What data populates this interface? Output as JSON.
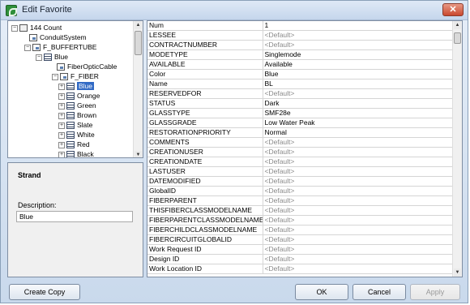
{
  "window": {
    "title": "Edit Favorite",
    "close_glyph": "✕"
  },
  "tree": {
    "items": [
      {
        "label": "144 Count",
        "icon": "count-icon",
        "expander": "−"
      },
      {
        "label": "ConduitSystem",
        "icon": "relationship-icon"
      },
      {
        "label": "F_BUFFERTUBE",
        "icon": "relationship-icon",
        "expander": "−"
      },
      {
        "label": "Blue",
        "icon": "table-icon",
        "expander": "−"
      },
      {
        "label": "FiberOpticCable",
        "icon": "relationship-icon"
      },
      {
        "label": "F_FIBER",
        "icon": "relationship-icon",
        "expander": "−"
      },
      {
        "label": "Blue",
        "icon": "table-icon",
        "expander": "+",
        "selected": true
      },
      {
        "label": "Orange",
        "icon": "table-icon",
        "expander": "+"
      },
      {
        "label": "Green",
        "icon": "table-icon",
        "expander": "+"
      },
      {
        "label": "Brown",
        "icon": "table-icon",
        "expander": "+"
      },
      {
        "label": "Slate",
        "icon": "table-icon",
        "expander": "+"
      },
      {
        "label": "White",
        "icon": "table-icon",
        "expander": "+"
      },
      {
        "label": "Red",
        "icon": "table-icon",
        "expander": "+"
      },
      {
        "label": "Black",
        "icon": "table-icon",
        "expander": "+"
      }
    ]
  },
  "details": {
    "title": "Strand",
    "description_label": "Description:",
    "description_value": "Blue"
  },
  "properties": [
    {
      "name": "Num",
      "value": "1"
    },
    {
      "name": "LESSEE",
      "value": "<Default>"
    },
    {
      "name": "CONTRACTNUMBER",
      "value": "<Default>"
    },
    {
      "name": "MODETYPE",
      "value": "Singlemode"
    },
    {
      "name": "AVAILABLE",
      "value": "Available"
    },
    {
      "name": "Color",
      "value": "Blue"
    },
    {
      "name": "Name",
      "value": "BL"
    },
    {
      "name": "RESERVEDFOR",
      "value": "<Default>"
    },
    {
      "name": "STATUS",
      "value": "Dark"
    },
    {
      "name": "GLASSTYPE",
      "value": "SMF28e"
    },
    {
      "name": "GLASSGRADE",
      "value": "Low Water Peak"
    },
    {
      "name": "RESTORATIONPRIORITY",
      "value": "Normal"
    },
    {
      "name": "COMMENTS",
      "value": "<Default>"
    },
    {
      "name": "CREATIONUSER",
      "value": "<Default>"
    },
    {
      "name": "CREATIONDATE",
      "value": "<Default>"
    },
    {
      "name": "LASTUSER",
      "value": "<Default>"
    },
    {
      "name": "DATEMODIFIED",
      "value": "<Default>"
    },
    {
      "name": "GlobalID",
      "value": "<Default>"
    },
    {
      "name": "FIBERPARENT",
      "value": "<Default>"
    },
    {
      "name": "THISFIBERCLASSMODELNAME",
      "value": "<Default>"
    },
    {
      "name": "FIBERPARENTCLASSMODELNAME",
      "value": "<Default>"
    },
    {
      "name": "FIBERCHILDCLASSMODELNAME",
      "value": "<Default>"
    },
    {
      "name": "FIBERCIRCUITGLOBALID",
      "value": "<Default>"
    },
    {
      "name": "Work Request ID",
      "value": "<Default>"
    },
    {
      "name": "Design ID",
      "value": "<Default>"
    },
    {
      "name": "Work Location ID",
      "value": "<Default>"
    }
  ],
  "buttons": {
    "create_copy": "Create Copy",
    "ok": "OK",
    "cancel": "Cancel",
    "apply": "Apply"
  },
  "colors": {
    "selection": "#316ac5",
    "default_text": "#888888",
    "chrome": "#c9d9ec"
  }
}
